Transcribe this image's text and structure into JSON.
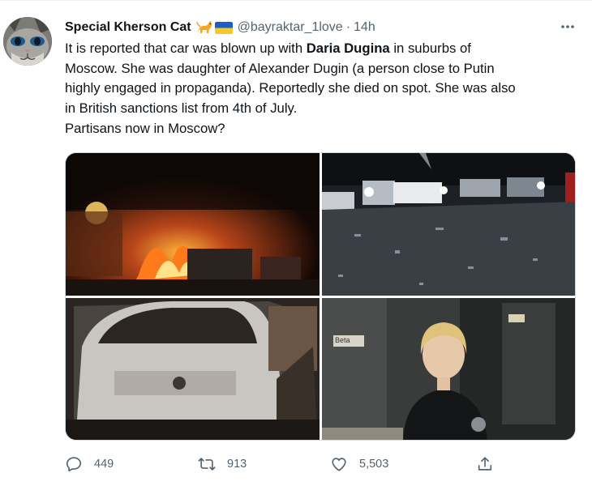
{
  "tweet": {
    "author_name": "Special Kherson Cat",
    "handle": "@bayraktar_1love",
    "separator": "·",
    "time": "14h",
    "text_lines": [
      {
        "before": "It is reported that car was blown up with ",
        "bold": "Daria Dugina",
        "after": " in suburbs of"
      },
      {
        "before": "Moscow. She was daughter of Alexander Dugin (a person close to Putin"
      },
      {
        "before": "highly engaged in propaganda). Reportedly she died on spot. She was also"
      },
      {
        "before": "in British sanctions list from 4th of July."
      },
      {
        "before": "Partisans now in Moscow?"
      }
    ],
    "photos": [
      {
        "icon": "fire-photo"
      },
      {
        "icon": "street-debris-photo"
      },
      {
        "icon": "burned-car-photo"
      },
      {
        "icon": "woman-portrait-photo",
        "sign_text": "Beta"
      }
    ],
    "actions": {
      "reply_count": "449",
      "retweet_count": "913",
      "like_count": "5,503"
    }
  },
  "colors": {
    "text_primary": "#0f1419",
    "text_secondary": "#536471",
    "border": "#cfd9de"
  }
}
